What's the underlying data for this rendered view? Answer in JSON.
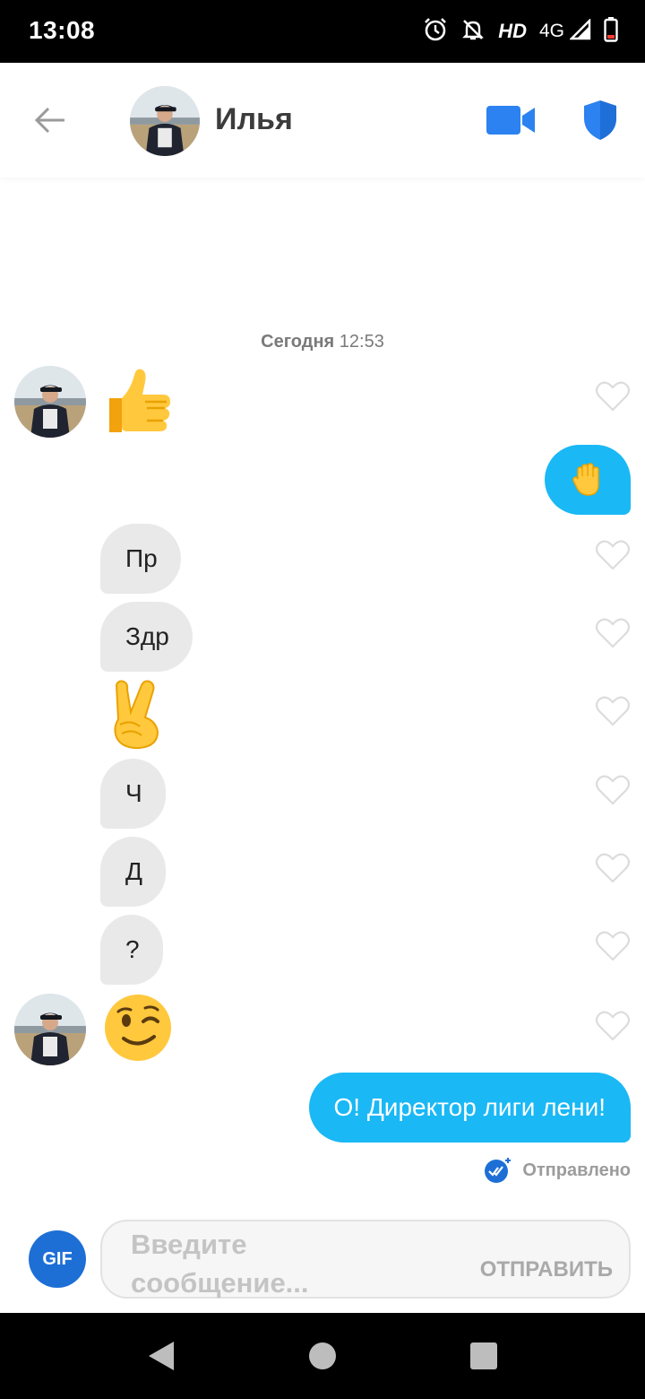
{
  "status_bar": {
    "time": "13:08",
    "hd_label": "HD",
    "network_label": "4G"
  },
  "header": {
    "contact_name": "Илья"
  },
  "chat": {
    "date_day": "Сегодня",
    "date_time": "12:53",
    "messages": [
      {
        "emoji": "👍"
      },
      {
        "emoji": "🖐"
      },
      {
        "text": "Пр"
      },
      {
        "text": "Здр"
      },
      {
        "emoji": "✌"
      },
      {
        "text": "Ч"
      },
      {
        "text": "Д"
      },
      {
        "text": "?"
      },
      {
        "emoji": "😉"
      },
      {
        "text": "О! Директор лиги лени!"
      }
    ],
    "sent_status": "Отправлено"
  },
  "composer": {
    "gif_label": "GIF",
    "placeholder": "Введите сообщение...",
    "send_label": "ОТПРАВИТЬ"
  },
  "colors": {
    "outgoing_bubble": "#1ab8f5",
    "incoming_bubble": "#e9e9e9",
    "accent_blue": "#1d6fd6",
    "icon_blue": "#2b82f0"
  }
}
